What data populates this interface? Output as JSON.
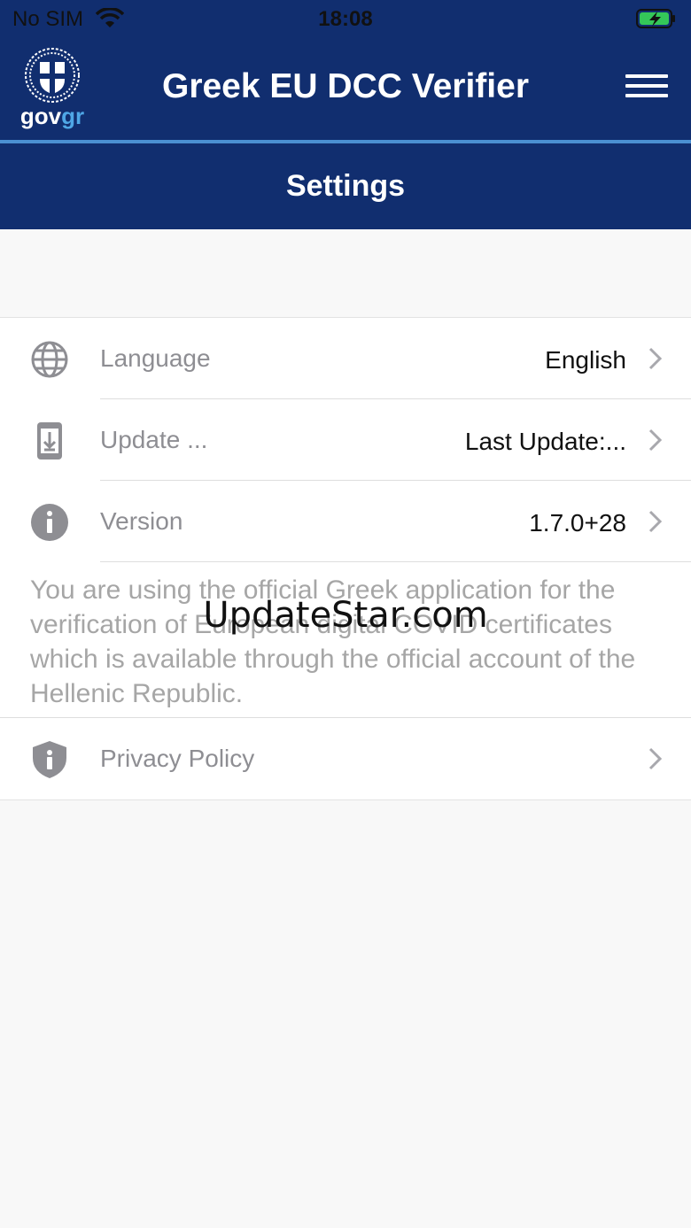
{
  "status_bar": {
    "carrier": "No SIM",
    "time": "18:08"
  },
  "header": {
    "logo_word_gov": "gov",
    "logo_word_gr": "gr",
    "title": "Greek EU DCC Verifier"
  },
  "page": {
    "title": "Settings"
  },
  "settings": {
    "rows": [
      {
        "label": "Language",
        "value": "English"
      },
      {
        "label": "Update ...",
        "value": "Last Update:..."
      },
      {
        "label": "Version",
        "value": "1.7.0+28"
      }
    ],
    "note": "You are using the official Greek application for the verification of European digital COVID certificates which is available through the official account of the Hellenic Republic.",
    "privacy": {
      "label": "Privacy Policy"
    }
  },
  "watermark": "UpdateStar.com",
  "colors": {
    "navy": "#112e6f",
    "accent": "#4b90d2",
    "icon_gray": "#8e8e93"
  }
}
